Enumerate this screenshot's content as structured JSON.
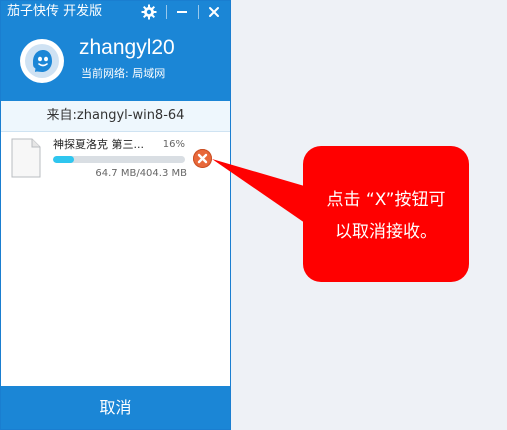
{
  "window": {
    "app_title": "茄子快传 开发版",
    "controls": {
      "settings_icon": "gear-icon",
      "minimize_icon": "minimize-icon",
      "close_icon": "close-icon"
    }
  },
  "profile": {
    "avatar_icon": "eggplant-avatar-icon",
    "username": "zhangyl20",
    "network_label": "当前网络:",
    "network_value": "局域网"
  },
  "sender": {
    "label": "来自:zhangyl-win8-64"
  },
  "transfer": {
    "file_icon": "document-icon",
    "file_name": "神探夏洛克 第三...",
    "percent_text": "16%",
    "progress": 0.16,
    "size_text": "64.7 MB/404.3 MB",
    "cancel_icon": "cancel-x-icon"
  },
  "footer": {
    "cancel_label": "取消"
  },
  "callout": {
    "line1": "点击 “X”按钮可",
    "line2": "以取消接收。"
  },
  "colors": {
    "brand_blue": "#1b86d6",
    "progress": "#2fc6ef",
    "cancel_orange": "#e8683a",
    "callout_red": "#ff0000"
  }
}
